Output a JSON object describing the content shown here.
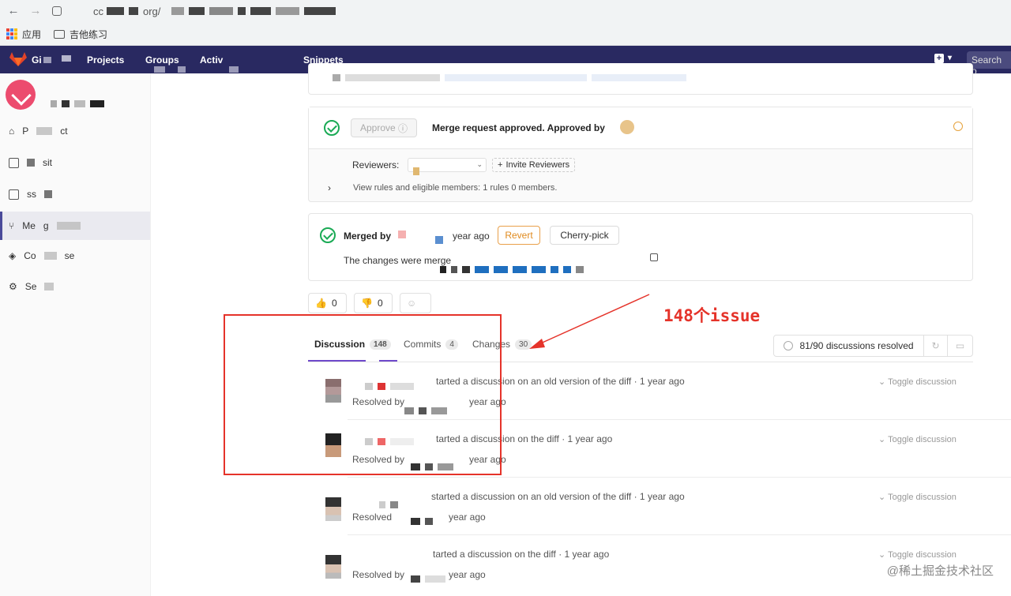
{
  "browser": {
    "url_prefix": "cc",
    "url_mid": "org/",
    "bookmarks": [
      "应用",
      "吉他练习"
    ]
  },
  "topnav": {
    "logo_text": "Gi",
    "items": [
      "Projects",
      "Groups",
      "Activ",
      "Snippets"
    ],
    "search_placeholder": "Search o"
  },
  "sidebar": {
    "items": [
      {
        "label": "P",
        "label2": "ct",
        "icon": "home-icon"
      },
      {
        "label": "",
        "label2": "sit",
        "icon": "file-icon"
      },
      {
        "label": "",
        "label2": "ss",
        "icon": "issues-icon"
      },
      {
        "label": "Me",
        "label2": "g",
        "icon": "merge-request-icon"
      },
      {
        "label": "Co",
        "label2": "se",
        "icon": "layers-icon"
      },
      {
        "label": "Se",
        "label2": "",
        "icon": "gear-icon"
      }
    ]
  },
  "approval": {
    "approve_label": "Approve",
    "status_text": "Merge request approved. Approved by",
    "reviewers_label": "Reviewers:",
    "invite_label": "Invite Reviewers",
    "rules_text": "View rules and eligible members: 1 rules 0 members."
  },
  "merged": {
    "merged_by": "Merged by",
    "time": "year ago",
    "revert_label": "Revert",
    "cherry_label": "Cherry-pick",
    "changes_text": "The changes were merge"
  },
  "reactions": {
    "thumbs_up_count": "0",
    "thumbs_down_count": "0"
  },
  "tabs": [
    {
      "label": "Discussion",
      "count": "148"
    },
    {
      "label": "Commits",
      "count": "4"
    },
    {
      "label": "Changes",
      "count": "30"
    }
  ],
  "resolved": {
    "text": "81/90 discussions resolved"
  },
  "discussions": [
    {
      "action": "tarted a discussion on an old version of the diff · 1 year ago",
      "resolved": "Resolved by",
      "resolved_time": "year ago",
      "toggle": "Toggle discussion"
    },
    {
      "action": "tarted a discussion on the diff · 1 year ago",
      "resolved": "Resolved by",
      "resolved_time": "year ago",
      "toggle": "Toggle discussion"
    },
    {
      "action": "started a discussion on an old version of the diff · 1 year ago",
      "resolved": "Resolved",
      "resolved_time": "year ago",
      "toggle": "Toggle discussion"
    },
    {
      "action": "tarted a discussion on the diff · 1 year ago",
      "resolved": "Resolved by",
      "resolved_time": "year ago",
      "toggle": "Toggle discussion"
    }
  ],
  "annotation": {
    "text": "148个issue"
  },
  "watermark": "@稀土掘金技术社区",
  "colors": {
    "nav_bg": "#292961",
    "accent": "#6e49cb",
    "success": "#1aaa55",
    "annotation": "#e5332a"
  }
}
